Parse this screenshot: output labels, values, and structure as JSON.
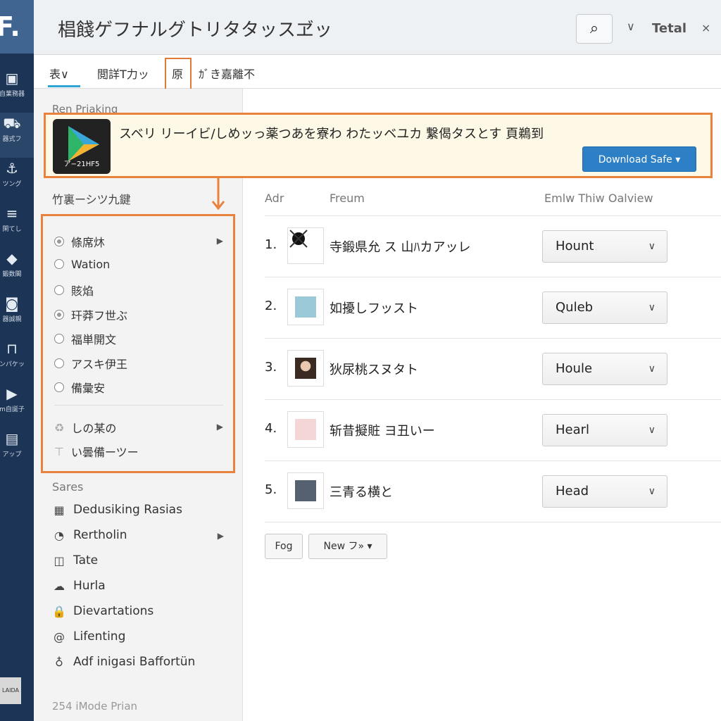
{
  "app": {
    "logo": "F.",
    "title": "椙餞ゲフナルグトリタタッスヹッ",
    "header_right": "Tetal"
  },
  "rail": [
    {
      "icon": "briefcase-icon",
      "glyph": "▣",
      "label": "自業務器"
    },
    {
      "icon": "truck-icon",
      "glyph": "⛟",
      "label": "器式フ"
    },
    {
      "icon": "anchor-icon",
      "glyph": "⚓",
      "label": "ツング"
    },
    {
      "icon": "list-icon",
      "glyph": "≡",
      "label": "閑てし"
    },
    {
      "icon": "apple-icon",
      "glyph": "◆",
      "label": "鍛数閣"
    },
    {
      "icon": "disk-icon",
      "glyph": "◙",
      "label": "器誠親"
    },
    {
      "icon": "frame-icon",
      "glyph": "⊓",
      "label": "ンパケッ"
    },
    {
      "icon": "play-icon",
      "glyph": "▶",
      "label": "m自誕子"
    },
    {
      "icon": "file-icon",
      "glyph": "▤",
      "label": "アップ"
    }
  ],
  "rail_bottom": "LAIDA",
  "tabs": [
    {
      "label": "表∨"
    },
    {
      "label": "閲詳T力ッ"
    },
    {
      "label": "原"
    },
    {
      "label": "ｶﾞき嘉離不"
    }
  ],
  "panel": {
    "section1": "Ren Priaking",
    "section2": "竹裏ーシツ九鍵",
    "options": [
      {
        "label": "條席炑",
        "state": "checked",
        "submenu": true
      },
      {
        "label": "Wation",
        "state": "off"
      },
      {
        "label": "賅焰",
        "state": "off"
      },
      {
        "label": "玕莽フ世ぶ",
        "state": "on"
      },
      {
        "label": "福単開文",
        "state": "off"
      },
      {
        "label": "アスキ伊王",
        "state": "off"
      },
      {
        "label": "備彙安",
        "state": "off"
      }
    ],
    "extra": [
      {
        "label": "しの某の",
        "icon": "recycle-icon",
        "submenu": true
      },
      {
        "label": "い曇備ーツー",
        "icon": "arrow-up-icon"
      }
    ],
    "section3": "Sares",
    "items": [
      {
        "label": "Dedusiking Rasias",
        "icon": "calendar-icon",
        "glyph": "▦"
      },
      {
        "label": "Rertholin",
        "icon": "clock-icon",
        "glyph": "◔",
        "submenu": true
      },
      {
        "label": "Tate",
        "icon": "tag-icon",
        "glyph": "◫"
      },
      {
        "label": "Hurla",
        "icon": "cloud-icon",
        "glyph": "☁"
      },
      {
        "label": "Dievartations",
        "icon": "lock-icon",
        "glyph": "🔒"
      },
      {
        "label": "Lifenting",
        "icon": "at-icon",
        "glyph": "@"
      },
      {
        "label": "Adf inigasi Baffortün",
        "icon": "bulb-icon",
        "glyph": "♁"
      }
    ],
    "footer": "254 iMode Prian"
  },
  "banner": {
    "app_label": "ア−21HF5",
    "text": "スベリ リーイビ/しめッっ薬つあを寮わ わたッベユカ 繋偈タスとす 頁鵜到",
    "download": "Download Safe ▾"
  },
  "table": {
    "headers": [
      "Adr",
      "Freum",
      "Emlw Thiw Oalview"
    ],
    "rows": [
      {
        "num": "1.",
        "name": "寺鍛県允 ス 山ﾊカアッレ",
        "value": "Hount",
        "thumb": "bug"
      },
      {
        "num": "2.",
        "name": "如擾しフッスト",
        "value": "Quleb",
        "thumb": "poster"
      },
      {
        "num": "3.",
        "name": "狄尿桃スヌタト",
        "value": "Houle",
        "thumb": "woman"
      },
      {
        "num": "4.",
        "name": "斩昔擬賍 ヨ丑いー",
        "value": "Hearl",
        "thumb": "flower"
      },
      {
        "num": "5.",
        "name": "三青る横と",
        "value": "Head",
        "thumb": "man"
      }
    ]
  },
  "buttons": {
    "fog": "Fog",
    "new": "New フ» ▾"
  },
  "colors": {
    "accent": "#e8823c",
    "primary": "#2d7fc6",
    "rail": "#1c3557"
  }
}
